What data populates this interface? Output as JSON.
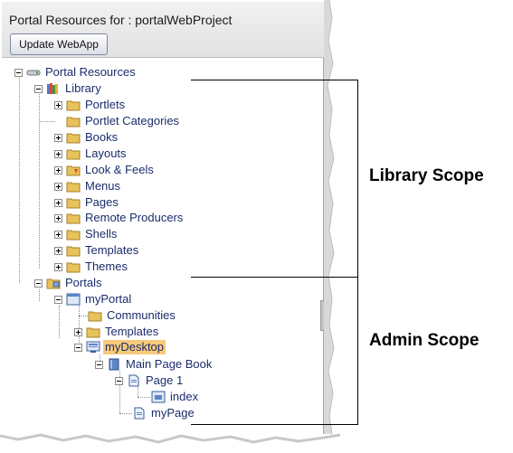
{
  "panel": {
    "title": "Portal Resources for : portalWebProject",
    "update_button": "Update WebApp"
  },
  "tree": {
    "root": "Portal Resources",
    "library": {
      "label": "Library",
      "items": [
        "Portlets",
        "Portlet Categories",
        "Books",
        "Layouts",
        "Look & Feels",
        "Menus",
        "Pages",
        "Remote Producers",
        "Shells",
        "Templates",
        "Themes"
      ]
    },
    "portals": {
      "label": "Portals",
      "portal": "myPortal",
      "communities": "Communities",
      "templates": "Templates",
      "desktop": "myDesktop",
      "book": "Main Page Book",
      "page1": "Page 1",
      "index": "index",
      "mypage": "myPage"
    }
  },
  "annotations": {
    "library_scope": "Library Scope",
    "admin_scope": "Admin Scope"
  },
  "colors": {
    "selected_bg": "#f8c97a",
    "label_text": "#1a2d6b",
    "folder": "#e8c25a"
  },
  "icons": {
    "root": "resources-icon",
    "library": "library-books-icon",
    "folder": "folder-icon",
    "portal": "portal-icon",
    "desktop": "desktop-icon",
    "book": "book-icon",
    "page": "page-icon"
  }
}
